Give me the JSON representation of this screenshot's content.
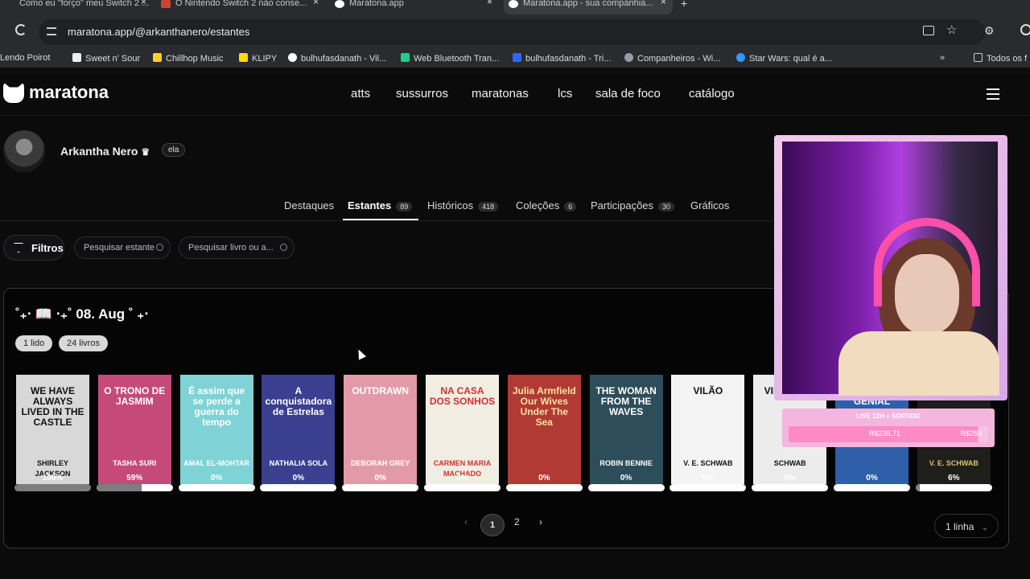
{
  "browser": {
    "tabs": [
      {
        "title": "Como eu \"forço\" meu Switch 2 ...",
        "fav": "#888"
      },
      {
        "title": "O Nintendo Switch 2 não conse...",
        "fav": "#c43"
      },
      {
        "title": "Maratona.app",
        "fav": "#fff"
      },
      {
        "title": "Maratona.app - sua companhia...",
        "fav": "#fff"
      }
    ],
    "url": "maratona.app/@arkanthanero/estantes",
    "bookmarks": [
      {
        "label": "Lendo Poirot",
        "color": "#8a6"
      },
      {
        "label": "Sweet n' Sour",
        "color": "#eee"
      },
      {
        "label": "Chillhop Music",
        "color": "#fc3"
      },
      {
        "label": "KLIPY",
        "color": "#fd0"
      },
      {
        "label": "bulhufasdanath - Vil...",
        "color": "#fff"
      },
      {
        "label": "Web Bluetooth Tran...",
        "color": "#2c8"
      },
      {
        "label": "bulhufasdanath - Tri...",
        "color": "#36f"
      },
      {
        "label": "Companheiros - Wi...",
        "color": "#99a"
      },
      {
        "label": "Star Wars: qual é a...",
        "color": "#39f"
      }
    ],
    "all_bookmarks": "Todos os f"
  },
  "app": {
    "logo": "maratona",
    "nav": [
      "atts",
      "sussurros",
      "maratonas",
      "lcs",
      "sala de foco",
      "catálogo"
    ]
  },
  "profile": {
    "name": "Arkantha Nero",
    "pronoun": "ela",
    "tabs": [
      {
        "label": "Destaques",
        "count": ""
      },
      {
        "label": "Estantes",
        "count": "89"
      },
      {
        "label": "Históricos",
        "count": "418"
      },
      {
        "label": "Coleções",
        "count": "6"
      },
      {
        "label": "Participações",
        "count": "30"
      },
      {
        "label": "Gráficos",
        "count": ""
      }
    ]
  },
  "filters": {
    "button": "Filtros",
    "search_shelf": "Pesquisar estante",
    "search_book": "Pesquisar livro ou a..."
  },
  "shelf": {
    "title": "˚₊‧ 📖 ‧₊˚ 08. Aug ˚ ₊‧",
    "chips": [
      "1 lido",
      "24 livros"
    ],
    "books": [
      {
        "title": "WE HAVE ALWAYS LIVED IN THE CASTLE",
        "author": "SHIRLEY JACKSON",
        "bg": "#d8d8d8",
        "fg": "#111",
        "progress": 100,
        "pct": "100%"
      },
      {
        "title": "O TRONO DE JASMIM",
        "author": "TASHA SURI",
        "bg": "#c54a7a",
        "fg": "#fff",
        "progress": 59,
        "pct": "59%"
      },
      {
        "title": "É assim que se perde a guerra do tempo",
        "author": "AMAL EL-MOHTAR",
        "bg": "#7fd3d6",
        "fg": "#fff",
        "progress": 0,
        "pct": "0%"
      },
      {
        "title": "A conquistadora de Estrelas",
        "author": "NATHALIA SOLA",
        "bg": "#3b3f8f",
        "fg": "#fff",
        "progress": 0,
        "pct": "0%"
      },
      {
        "title": "OUTDRAWN",
        "author": "DEBORAH GREY",
        "bg": "#e39aa8",
        "fg": "#fff",
        "progress": 0,
        "pct": "0%"
      },
      {
        "title": "NA CASA DOS SONHOS",
        "author": "CARMEN MARIA MACHADO",
        "bg": "#f2ede2",
        "fg": "#c33",
        "progress": 0,
        "pct": "0%"
      },
      {
        "title": "Julia Armfield Our Wives Under The Sea",
        "author": "",
        "bg": "#b23a35",
        "fg": "#f5e3a0",
        "progress": 0,
        "pct": "0%"
      },
      {
        "title": "THE WOMAN FROM THE WAVES",
        "author": "ROBIN BENNIE",
        "bg": "#2e4d5a",
        "fg": "#fff",
        "progress": 0,
        "pct": "0%"
      },
      {
        "title": "VILÃO",
        "author": "V. E. SCHWAB",
        "bg": "#f4f4f4",
        "fg": "#111",
        "progress": 0,
        "pct": "0%"
      },
      {
        "title": "VINGANÇA",
        "author": "SCHWAB",
        "bg": "#ececec",
        "fg": "#111",
        "progress": 0,
        "pct": "0%"
      },
      {
        "title": "A AMIGA GENIAL",
        "author": "",
        "bg": "#2f5fa8",
        "fg": "#fff",
        "progress": 0,
        "pct": "0%"
      },
      {
        "title": "",
        "author": "V. E. SCHWAB",
        "bg": "#1e1e1a",
        "fg": "#d9c37a",
        "progress": 6,
        "pct": "6%"
      }
    ],
    "pages": [
      "1",
      "2"
    ],
    "rows_select": "1 linha"
  },
  "overlay": {
    "donation_title": "LIVE 12H + SORTEIO",
    "donation_current": "R$238.71",
    "donation_goal": "R$250",
    "donation_progress": 0.95
  },
  "colors": {
    "accent": "#ffffff",
    "background": "#0b0b0c",
    "stream_pink": "#ff4fa8"
  }
}
